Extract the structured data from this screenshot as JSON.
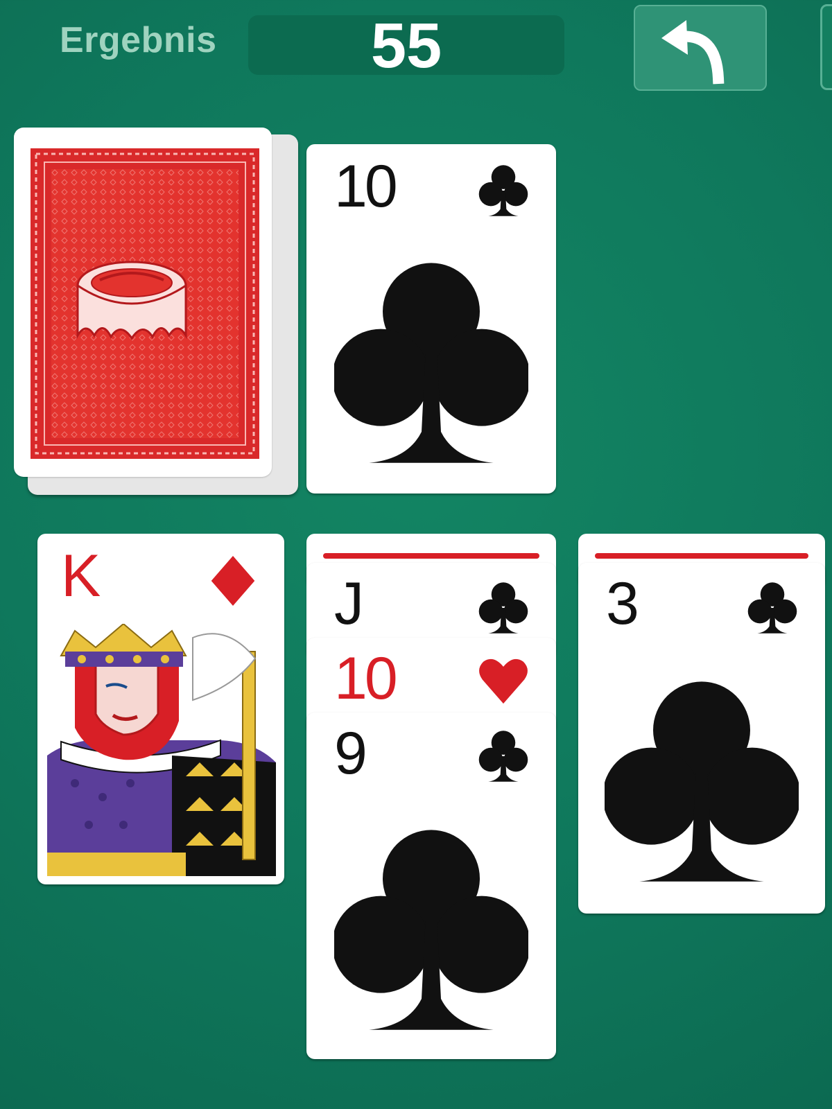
{
  "header": {
    "score_label": "Ergebnis",
    "score_value": "55",
    "undo_icon": "undo-arrow-icon"
  },
  "colors": {
    "felt": "#0f7a5d",
    "score_panel": "#0c6b50",
    "undo_button": "#2f9376",
    "red_suit": "#d81f26",
    "card_back": "#e3332e"
  },
  "stock": {
    "icon": "card-back-crown-design"
  },
  "waste": {
    "rank": "10",
    "suit": "clubs",
    "suit_glyph": "♣"
  },
  "tableau": [
    {
      "cards": [
        {
          "rank": "K",
          "suit": "diamonds",
          "suit_glyph": "♦",
          "face": "king-illustration"
        }
      ]
    },
    {
      "cards": [
        {
          "hidden": true
        },
        {
          "rank": "J",
          "suit": "clubs",
          "suit_glyph": "♣"
        },
        {
          "rank": "10",
          "suit": "hearts",
          "suit_glyph": "♥"
        },
        {
          "rank": "9",
          "suit": "clubs",
          "suit_glyph": "♣"
        }
      ]
    },
    {
      "cards": [
        {
          "hidden": true
        },
        {
          "rank": "3",
          "suit": "clubs",
          "suit_glyph": "♣"
        }
      ]
    }
  ]
}
